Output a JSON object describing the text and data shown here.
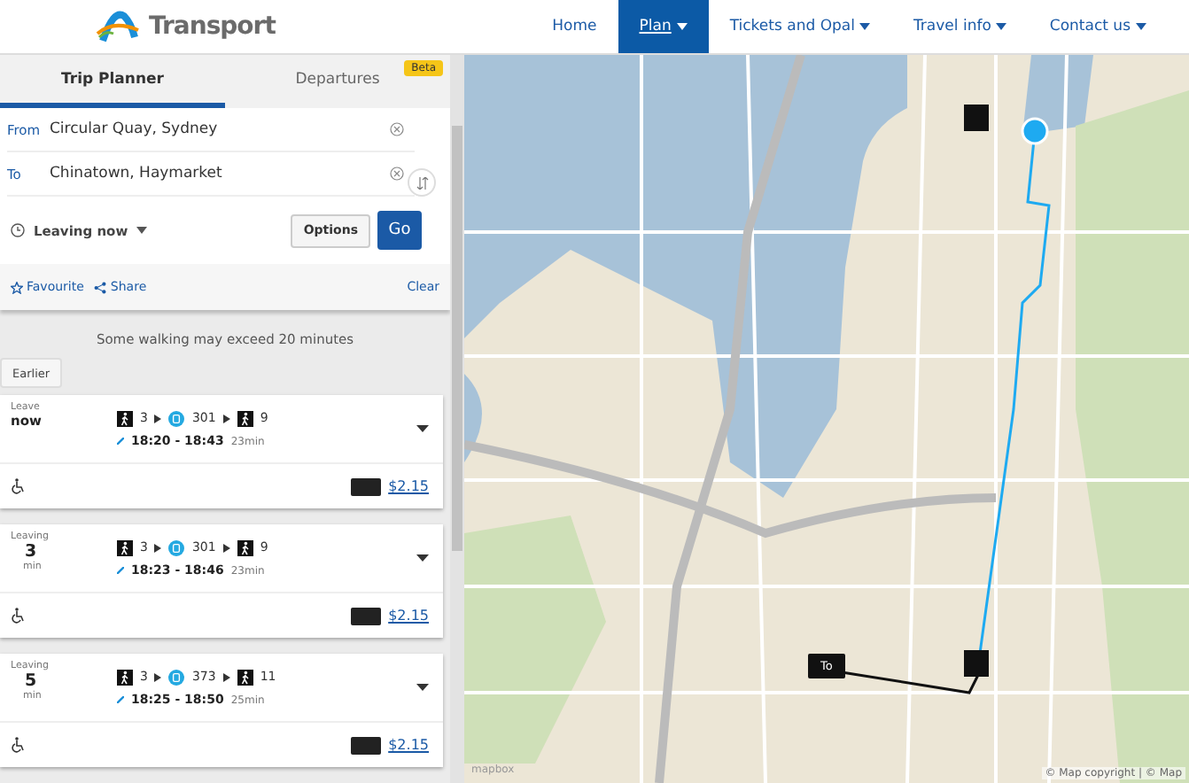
{
  "header": {
    "logo_text": "Transport",
    "nav": [
      {
        "label": "Home",
        "selected": false,
        "dropdown": false
      },
      {
        "label": "Plan",
        "selected": true,
        "dropdown": true
      },
      {
        "label": "Tickets and Opal",
        "selected": false,
        "dropdown": true
      },
      {
        "label": "Travel info",
        "selected": false,
        "dropdown": true
      },
      {
        "label": "Contact us",
        "selected": false,
        "dropdown": true
      }
    ]
  },
  "tabs": [
    {
      "label": "Trip Planner",
      "selected": true
    },
    {
      "label": "Departures",
      "selected": false,
      "badge": "Beta"
    }
  ],
  "form": {
    "from_label": "From",
    "from_value": "Circular Quay, Sydney",
    "to_label": "To",
    "to_value": "Chinatown, Haymarket",
    "when": "Leaving now",
    "options_button": "Options",
    "go_button": "Go"
  },
  "actions": {
    "favourite": "Favourite",
    "share": "Share",
    "clear": "Clear"
  },
  "notice": "Some walking may exceed 20 minutes",
  "earlier_button": "Earlier",
  "trips": [
    {
      "leave_label": "Leave",
      "leave_value": "now",
      "legs": [
        {
          "kind": "walk",
          "label": "3"
        },
        {
          "kind": "bus",
          "label": "301"
        },
        {
          "kind": "walk",
          "label": "9"
        }
      ],
      "times": "18:20 - 18:43",
      "duration": "23min",
      "price": "$2.15"
    },
    {
      "leave_label": "Leaving",
      "leave_value": "3",
      "leave_unit": "min",
      "legs": [
        {
          "kind": "walk",
          "label": "3"
        },
        {
          "kind": "bus",
          "label": "301"
        },
        {
          "kind": "walk",
          "label": "9"
        }
      ],
      "times": "18:23 - 18:46",
      "duration": "23min",
      "price": "$2.15"
    },
    {
      "leave_label": "Leaving",
      "leave_value": "5",
      "leave_unit": "min",
      "legs": [
        {
          "kind": "walk",
          "label": "3"
        },
        {
          "kind": "bus",
          "label": "373"
        },
        {
          "kind": "walk",
          "label": "11"
        }
      ],
      "times": "18:25 - 18:50",
      "duration": "25min",
      "price": "$2.15"
    }
  ],
  "map": {
    "destination_label": "To",
    "logo": "mapbox",
    "attribution": "© Map copyright | © Map"
  }
}
